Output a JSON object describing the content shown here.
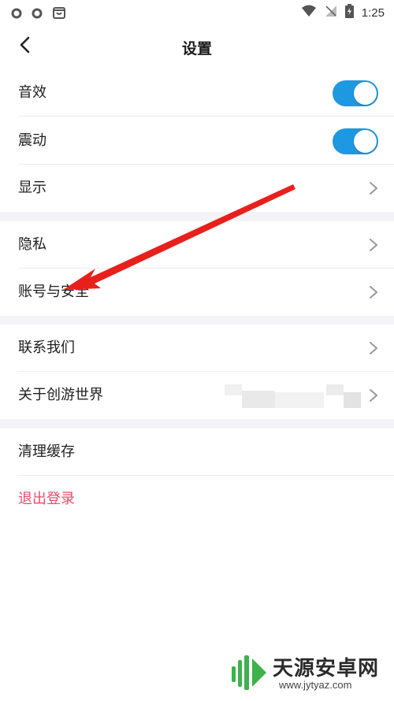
{
  "status_bar": {
    "time": "1:25",
    "battery_icon": "battery-charging-icon",
    "signal_icon": "signal-icon",
    "wifi_icon": "wifi-icon"
  },
  "header": {
    "title": "设置",
    "back_icon": "chevron-left-icon"
  },
  "sections": {
    "sound": {
      "label": "音效",
      "toggle_on": true
    },
    "vibrate": {
      "label": "震动",
      "toggle_on": true
    },
    "display": {
      "label": "显示"
    },
    "privacy": {
      "label": "隐私"
    },
    "account": {
      "label": "账号与安全"
    },
    "contact": {
      "label": "联系我们"
    },
    "about": {
      "label": "关于创游世界"
    },
    "clear_cache": {
      "label": "清理缓存"
    },
    "logout": {
      "label": "退出登录"
    }
  },
  "watermark": {
    "title": "天源安卓网",
    "url": "www.jytyaz.com"
  },
  "colors": {
    "toggle_accent": "#1e98e0",
    "logout_text": "#ef4a6b",
    "arrow": "#e8201c",
    "section_gap": "#f4f4f6"
  }
}
